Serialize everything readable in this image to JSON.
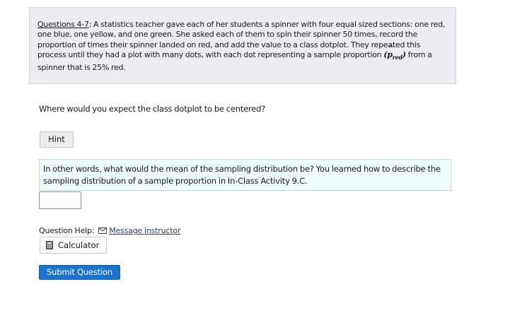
{
  "context": {
    "label": "Questions 4-7",
    "text_before": ": A statistics teacher gave each of her students a spinner with four equal sized sections: one red, one blue, one yellow, and one green. She asked each of them to spin their spinner 50 times, record the proportion of times their spinner landed on red, and add the value to a class dotplot. They repeated this process until they had a plot with many dots, with each dot representing a sample proportion ",
    "p_hat_open": "(",
    "p_hat_symbol": "p",
    "p_hat_subscript": "red",
    "p_hat_close": ")",
    "text_after": " from a spinner that is 25% red."
  },
  "question": {
    "text": "Where would you expect the class dotplot to be centered?"
  },
  "hint": {
    "button_label": "Hint",
    "text": "In other words, what would the mean of the sampling distribution be? You learned how to describe the sampling distribution of a sample proportion in In-Class Activity 9.C."
  },
  "answer": {
    "value": "",
    "placeholder": ""
  },
  "help": {
    "label": "Question Help:",
    "message_link": "Message instructor",
    "calculator_label": "Calculator",
    "mail_icon": "envelope-icon",
    "calc_icon": "calculator-icon"
  },
  "submit": {
    "label": "Submit Question"
  },
  "colors": {
    "context_bg": "#ecedf1",
    "hint_bg": "#effcfe",
    "submit_bg": "#1c73c8",
    "link": "#33415c"
  }
}
